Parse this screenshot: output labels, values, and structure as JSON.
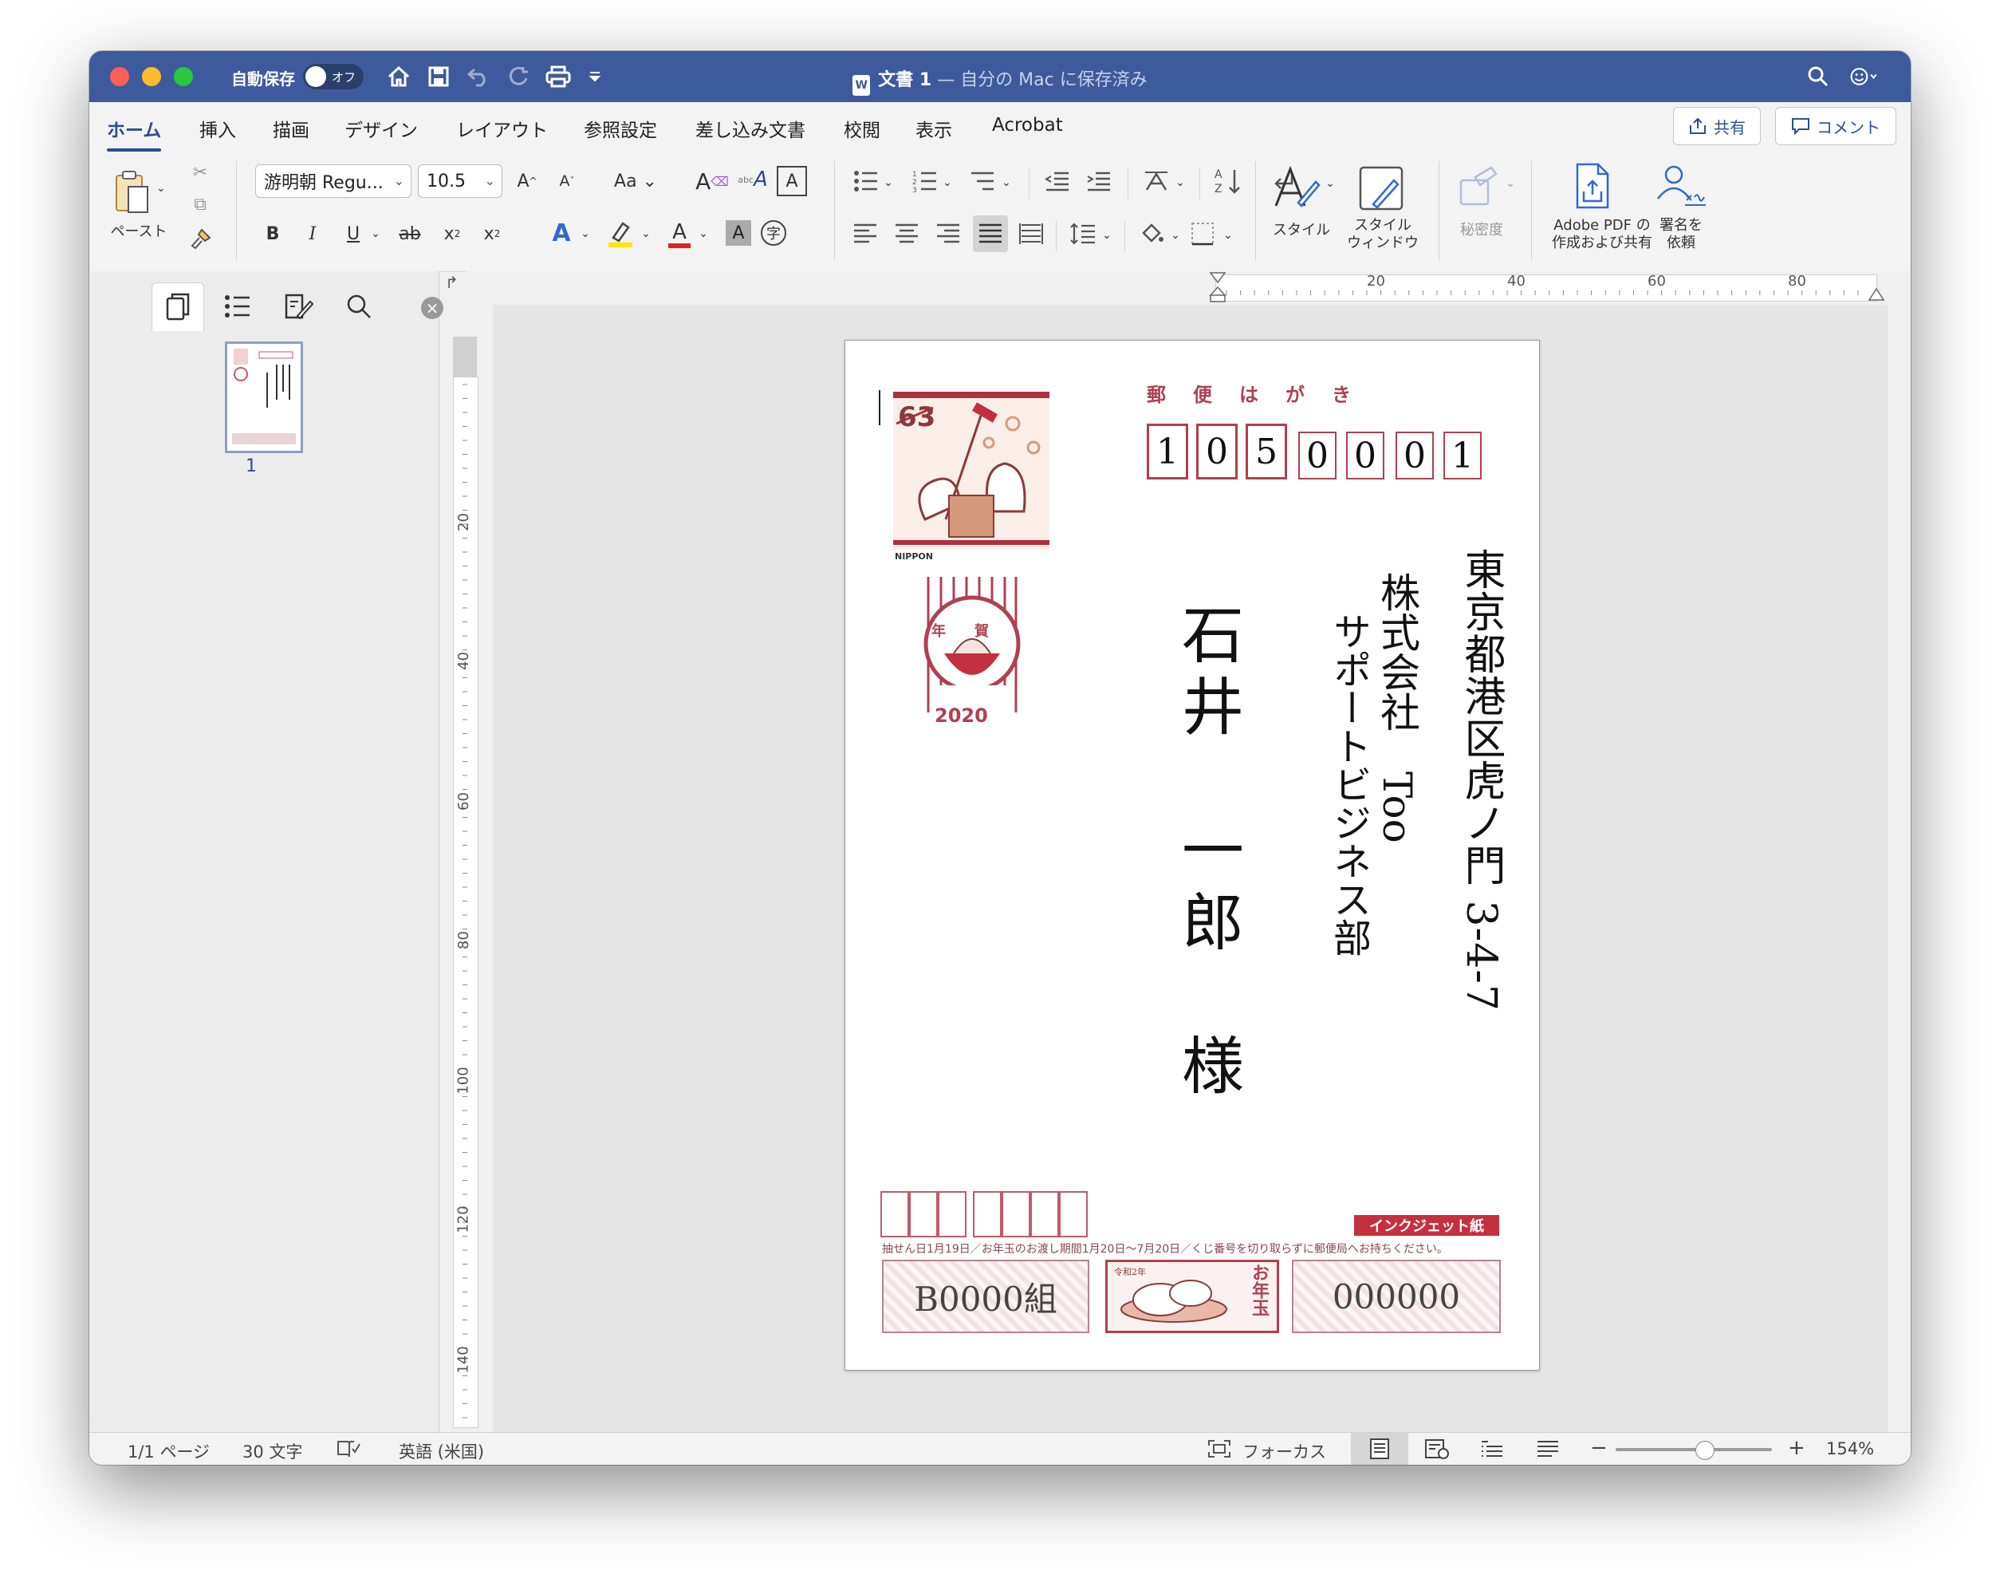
{
  "titlebar": {
    "autosave_label": "自動保存",
    "toggle_label": "オフ",
    "doc_name": "文書 1",
    "doc_status": " — 自分の Mac に保存済み"
  },
  "tabs": [
    "ホーム",
    "挿入",
    "描画",
    "デザイン",
    "レイアウト",
    "参照設定",
    "差し込み文書",
    "校閲",
    "表示",
    "Acrobat"
  ],
  "ribbon_actions": {
    "share": "共有",
    "comment": "コメント"
  },
  "ribbon": {
    "paste_label": "ペースト",
    "font_name": "游明朝 Regu...",
    "font_size": "10.5",
    "styles_label": "スタイル",
    "styles_pane_line1": "スタイル",
    "styles_pane_line2": "ウィンドウ",
    "sensitivity_label": "秘密度",
    "adobe_line1": "Adobe PDF の",
    "adobe_line2": "作成および共有",
    "sign_line1": "署名を",
    "sign_line2": "依頼"
  },
  "sidebar": {
    "page_number": "1"
  },
  "ruler": {
    "h_ticks": [
      "20",
      "40",
      "60",
      "80"
    ],
    "v_ticks": [
      "20",
      "40",
      "60",
      "80",
      "100",
      "120",
      "140"
    ]
  },
  "postcard": {
    "header": "郵便はがき",
    "stamp_value": "63",
    "stamp_brand": "NIPPON",
    "postmark_year": "2020",
    "postmark_text": "年賀",
    "zip": [
      "1",
      "0",
      "5",
      "0",
      "0",
      "0",
      "1"
    ],
    "address": "東京都港区虎ノ門 3-4-7",
    "company_line1": "株式会社　Too",
    "company_line2": "サポートビジネス部",
    "recipient": "石井　一郎　様",
    "inkjet_label": "インクジェット紙",
    "lottery_text": "抽せん日1月19日／お年玉のお渡し期間1月20日〜7月20日／くじ番号を切り取らずに郵便局へお持ちください。",
    "lottery_group": "B0000組",
    "lottery_number": "000000",
    "otoshidama": "お年玉",
    "reiwa": "令和2年"
  },
  "status": {
    "pages": "1/1 ページ",
    "words": "30 文字",
    "language": "英語 (米国)",
    "focus": "フォーカス",
    "zoom": "154%"
  }
}
